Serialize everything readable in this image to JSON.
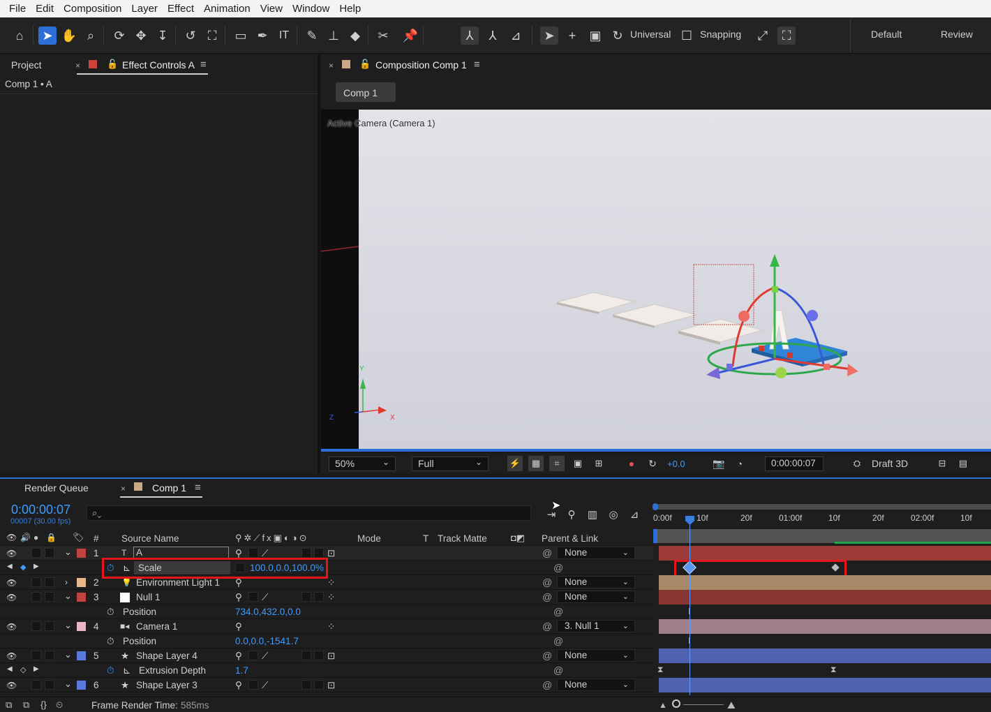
{
  "menu": [
    "File",
    "Edit",
    "Composition",
    "Layer",
    "Effect",
    "Animation",
    "View",
    "Window",
    "Help"
  ],
  "toolbar": {
    "universal_label": "Universal",
    "snapping_label": "Snapping",
    "workspace_default": "Default",
    "workspace_review": "Review",
    "icons": [
      "home-icon",
      "selection-icon",
      "hand-icon",
      "zoom-icon",
      "orbit-icon",
      "track-xy-icon",
      "dolly-icon",
      "rotate-icon",
      "pan-behind-icon",
      "rectangle-icon",
      "pen-icon",
      "type-icon",
      "brush-icon",
      "clone-stamp-icon",
      "eraser-icon",
      "roto-brush-icon",
      "puppet-pin-icon"
    ]
  },
  "left_panel": {
    "tab_project": "Project",
    "tab_effect_controls": "Effect Controls A",
    "breadcrumb": "Comp 1 • A"
  },
  "comp_panel": {
    "tab_title": "Composition Comp 1",
    "comp_tab": "Comp 1",
    "camera_label": "Active Camera (Camera 1)",
    "axis_x": "X",
    "axis_y": "Y",
    "axis_z": "Z",
    "zoom": "50%",
    "resolution": "Full",
    "exposure": "+0.0",
    "timecode": "0:00:00:07",
    "renderer": "Draft 3D"
  },
  "timeline": {
    "tab_render_queue": "Render Queue",
    "tab_comp": "Comp 1",
    "current_time": "0:00:00:07",
    "frame_info": "00007 (30.00 fps)",
    "search_placeholder": "",
    "headers": {
      "num": "#",
      "source_name": "Source Name",
      "mode": "Mode",
      "t": "T",
      "track_matte": "Track Matte",
      "parent_link": "Parent & Link"
    },
    "ruler": [
      "0:00f",
      "10f",
      "20f",
      "01:00f",
      "10f",
      "20f",
      "02:00f",
      "10f"
    ],
    "layers": [
      {
        "num": "1",
        "name": "A",
        "parent": "None",
        "color": "#c2433b",
        "type": "text"
      },
      {
        "prop": "Scale",
        "value": "100.0,0.0,100.0%"
      },
      {
        "num": "2",
        "name": "Environment Light 1",
        "parent": "None",
        "color": "#e6b88a",
        "type": "light"
      },
      {
        "num": "3",
        "name": "Null 1",
        "parent": "None",
        "color": "#c2433b",
        "type": "null"
      },
      {
        "prop": "Position",
        "value": "734.0,432.0,0.0"
      },
      {
        "num": "4",
        "name": "Camera 1",
        "parent": "3. Null 1",
        "color": "#e8b7c6",
        "type": "camera"
      },
      {
        "prop": "Position",
        "value": "0.0,0.0,-1541.7"
      },
      {
        "num": "5",
        "name": "Shape Layer 4",
        "parent": "None",
        "color": "#5a7ae0",
        "type": "shape"
      },
      {
        "prop": "Extrusion Depth",
        "value": "1.7"
      },
      {
        "num": "6",
        "name": "Shape Layer 3",
        "parent": "None",
        "color": "#5a7ae0",
        "type": "shape"
      }
    ],
    "footer": {
      "render_label": "Frame Render Time:",
      "render_value": "585ms"
    }
  }
}
